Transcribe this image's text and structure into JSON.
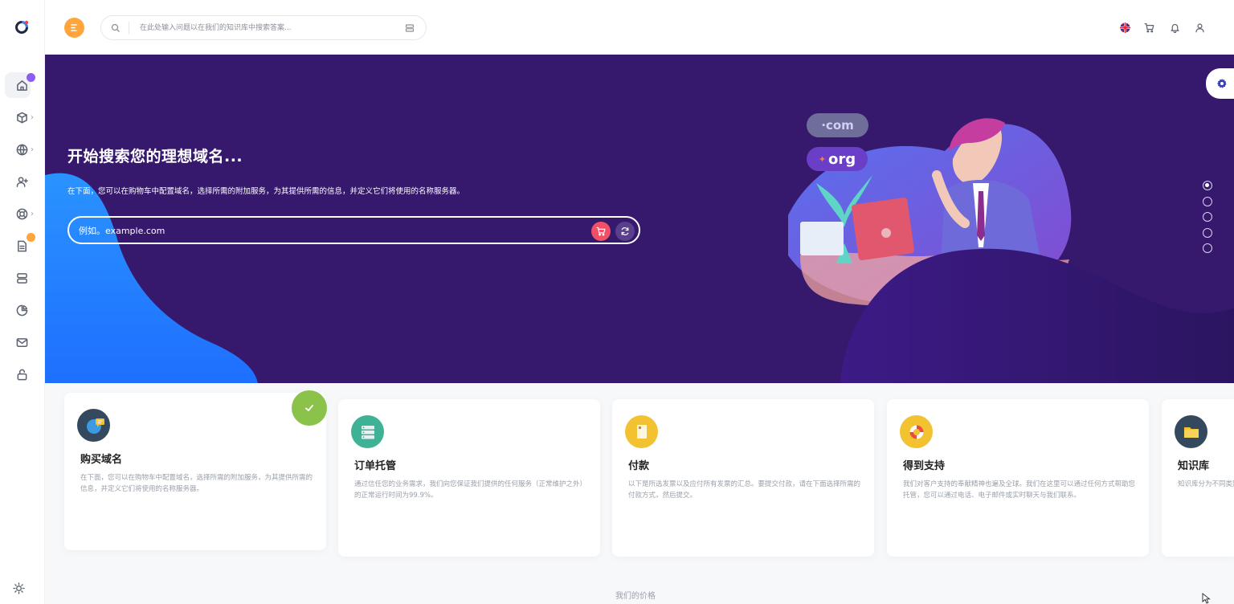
{
  "header": {
    "search_placeholder": "在此处输入问题以在我们的知识库中搜索答案..."
  },
  "hero": {
    "title": "开始搜索您的理想域名...",
    "subtitle": "在下面，您可以在购物车中配置域名，选择所需的附加服务，为其提供所需的信息，并定义它们将使用的名称服务器。",
    "domain_placeholder": "例如。example.com",
    "tld_com": "·com",
    "tld_org": "org"
  },
  "cards": [
    {
      "title": "购买域名",
      "desc": "在下面，您可以在购物车中配置域名，选择所需的附加服务，为其提供所需的信息，并定义它们将使用的名称服务器。",
      "color": "#34495e"
    },
    {
      "title": "订单托管",
      "desc": "通过信任您的业务需求，我们向您保证我们提供的任何服务（正常维护之外）的正常运行时间为99.9%。",
      "color": "#3fb295"
    },
    {
      "title": "付款",
      "desc": "以下是所选发票以及应付所有发票的汇总。要提交付款，请在下面选择所需的付款方式，然后提交。",
      "color": "#f2c230"
    },
    {
      "title": "得到支持",
      "desc": "我们对客户支持的奉献精神也遍及全球。我们在这里可以通过任何方式帮助您托管，您可以通过电话、电子邮件或实时聊天与我们联系。",
      "color": "#f2c230"
    },
    {
      "title": "知识库",
      "desc": "知识库分为不同类别，以帮助您更快地找到答案，搜索问题的答案。",
      "color": "#34495e"
    }
  ],
  "footer": {
    "pricing_label": "我们的价格"
  },
  "colors": {
    "accent": "#ffa53b",
    "hero_bg": "#36196d",
    "cart_red": "#f05066",
    "success": "#8bc34a"
  }
}
